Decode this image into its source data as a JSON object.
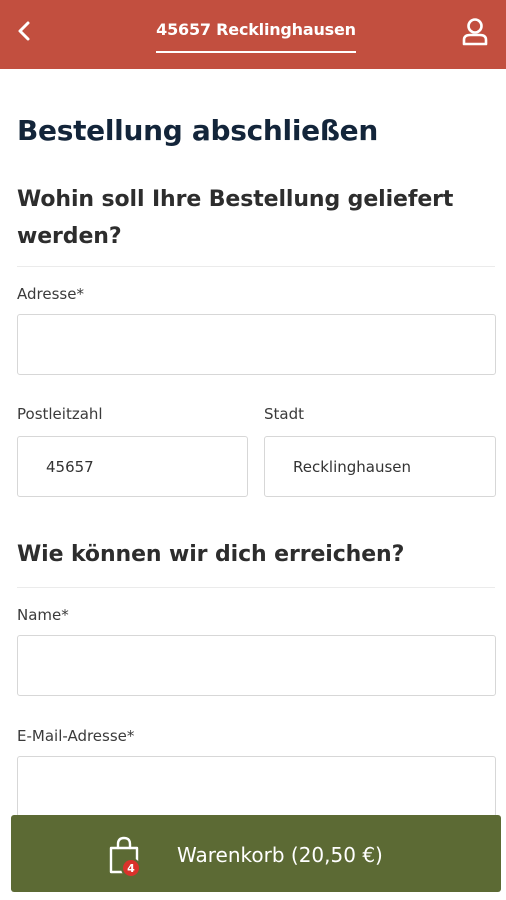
{
  "header": {
    "location": "45657 Recklinghausen",
    "bg_color": "#c24f3f"
  },
  "page": {
    "title": "Bestellung abschließen"
  },
  "delivery_section": {
    "title": "Wohin soll Ihre Bestellung geliefert werden?",
    "address_label": "Adresse*",
    "address_value": "",
    "postcode_label": "Postleitzahl",
    "postcode_value": "45657",
    "city_label": "Stadt",
    "city_value": "Recklinghausen"
  },
  "contact_section": {
    "title": "Wie können wir dich erreichen?",
    "name_label": "Name*",
    "name_value": "",
    "email_label": "E-Mail-Adresse*",
    "email_value": ""
  },
  "cart": {
    "label": "Warenkorb (20,50 €)",
    "badge_count": "4",
    "bg_color": "#5c6a34"
  },
  "icons": {
    "back": "chevron-left-icon",
    "user": "user-icon",
    "cart": "shopping-bag-icon"
  }
}
